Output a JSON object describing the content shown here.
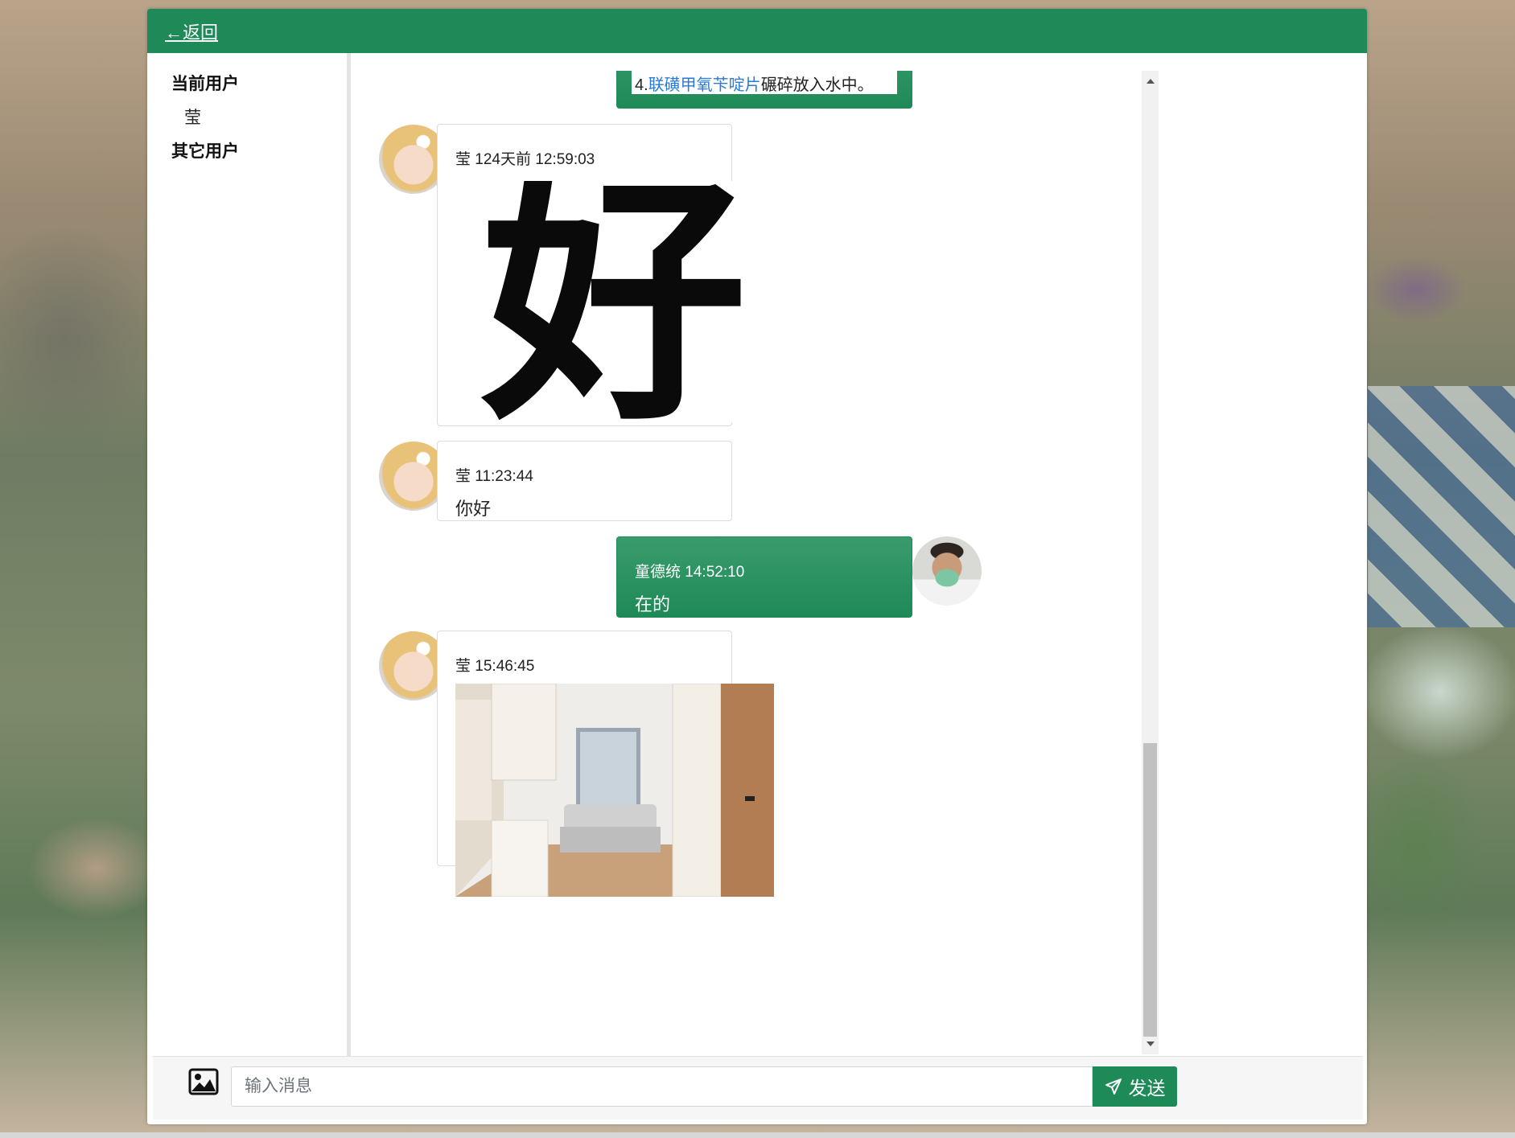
{
  "header": {
    "back_label": "←返回"
  },
  "sidebar": {
    "current_user_heading": "当前用户",
    "current_user_name": "莹",
    "other_users_heading": "其它用户"
  },
  "messages": [
    {
      "side": "right",
      "partial": true,
      "prefix": "4.",
      "link_text": "联磺甲氧苄啶片",
      "suffix": "碾碎放入水中。"
    },
    {
      "side": "left",
      "sender": "莹",
      "time": "124天前 12:59:03",
      "image": "calligraphy-hao",
      "image_text": "好"
    },
    {
      "side": "left",
      "sender": "莹",
      "time": "11:23:44",
      "text": "你好"
    },
    {
      "side": "right",
      "sender": "童德统",
      "time": "14:52:10",
      "text": "在的"
    },
    {
      "side": "left",
      "sender": "莹",
      "time": "15:46:45",
      "image": "bedroom-photo"
    }
  ],
  "composer": {
    "placeholder": "输入消息",
    "value": "",
    "send_label": "发送"
  },
  "colors": {
    "brand": "#1e8a57",
    "link": "#2b7bd6",
    "bubble_border": "#dcdcdc"
  },
  "icons": {
    "image_button": "image-icon",
    "send": "send-plane-icon"
  }
}
